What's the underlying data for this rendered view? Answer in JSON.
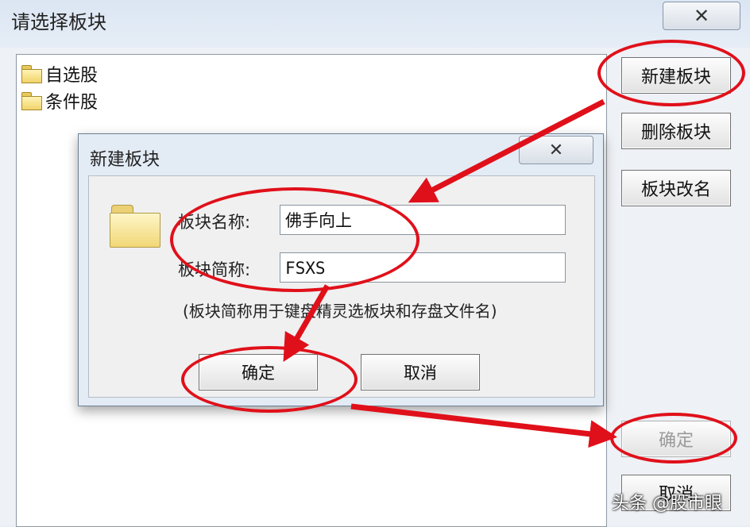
{
  "outer": {
    "title": "请选择板块",
    "close_glyph": "✕",
    "tree_items": [
      {
        "label": "自选股",
        "icon": "folder-icon"
      },
      {
        "label": "条件股",
        "icon": "folder-icon"
      }
    ],
    "buttons": {
      "new": "新建板块",
      "delete": "删除板块",
      "rename": "板块改名",
      "ok": "确定",
      "cancel": "取消"
    }
  },
  "dialog": {
    "title": "新建板块",
    "close_glyph": "✕",
    "name_label": "板块名称:",
    "name_value": "佛手向上",
    "abbr_label": "板块简称:",
    "abbr_value": "FSXS",
    "hint": "(板块简称用于键盘精灵选板块和存盘文件名)",
    "ok": "确定",
    "cancel": "取消"
  },
  "watermark": "头条 @股市眼",
  "colors": {
    "annotation": "#e0101a",
    "folder": "#f1d776"
  }
}
